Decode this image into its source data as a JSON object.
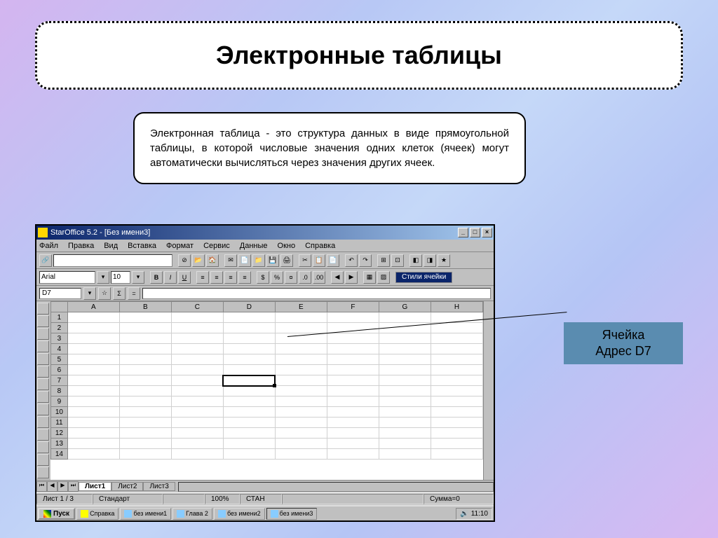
{
  "slide": {
    "title": "Электронные таблицы",
    "description": "Электронная таблица - это структура данных в виде прямоугольной таблицы, в которой числовые значения одних клеток (ячеек) могут автоматически вычисляться через значения других ячеек."
  },
  "app": {
    "title": "StarOffice 5.2 - [Без имени3]",
    "menu": [
      "Файл",
      "Правка",
      "Вид",
      "Вставка",
      "Формат",
      "Сервис",
      "Данные",
      "Окно",
      "Справка"
    ],
    "font_name": "Arial",
    "font_size": "10",
    "styles_label": "Стили ячейки",
    "cell_ref": "D7",
    "sigma": "Σ",
    "equals": "=",
    "columns": [
      "A",
      "B",
      "C",
      "D",
      "E",
      "F",
      "G",
      "H"
    ],
    "rows": [
      "1",
      "2",
      "3",
      "4",
      "5",
      "6",
      "7",
      "8",
      "9",
      "10",
      "11",
      "12",
      "13",
      "14"
    ],
    "selected_cell": "D7",
    "sheet_info": "Лист 1 / 3",
    "sheets": [
      "Лист1",
      "Лист2",
      "Лист3"
    ],
    "status": {
      "mode": "Стандарт",
      "zoom": "100%",
      "ins": "СТАН",
      "sum": "Сумма=0"
    },
    "start": "Пуск",
    "tasks": [
      "Справка",
      "без имени1",
      "Глава 2",
      "без имени2",
      "без имени3"
    ],
    "clock": "11:10"
  },
  "callout": {
    "line1": "Ячейка",
    "line2": "Адрес D7"
  }
}
